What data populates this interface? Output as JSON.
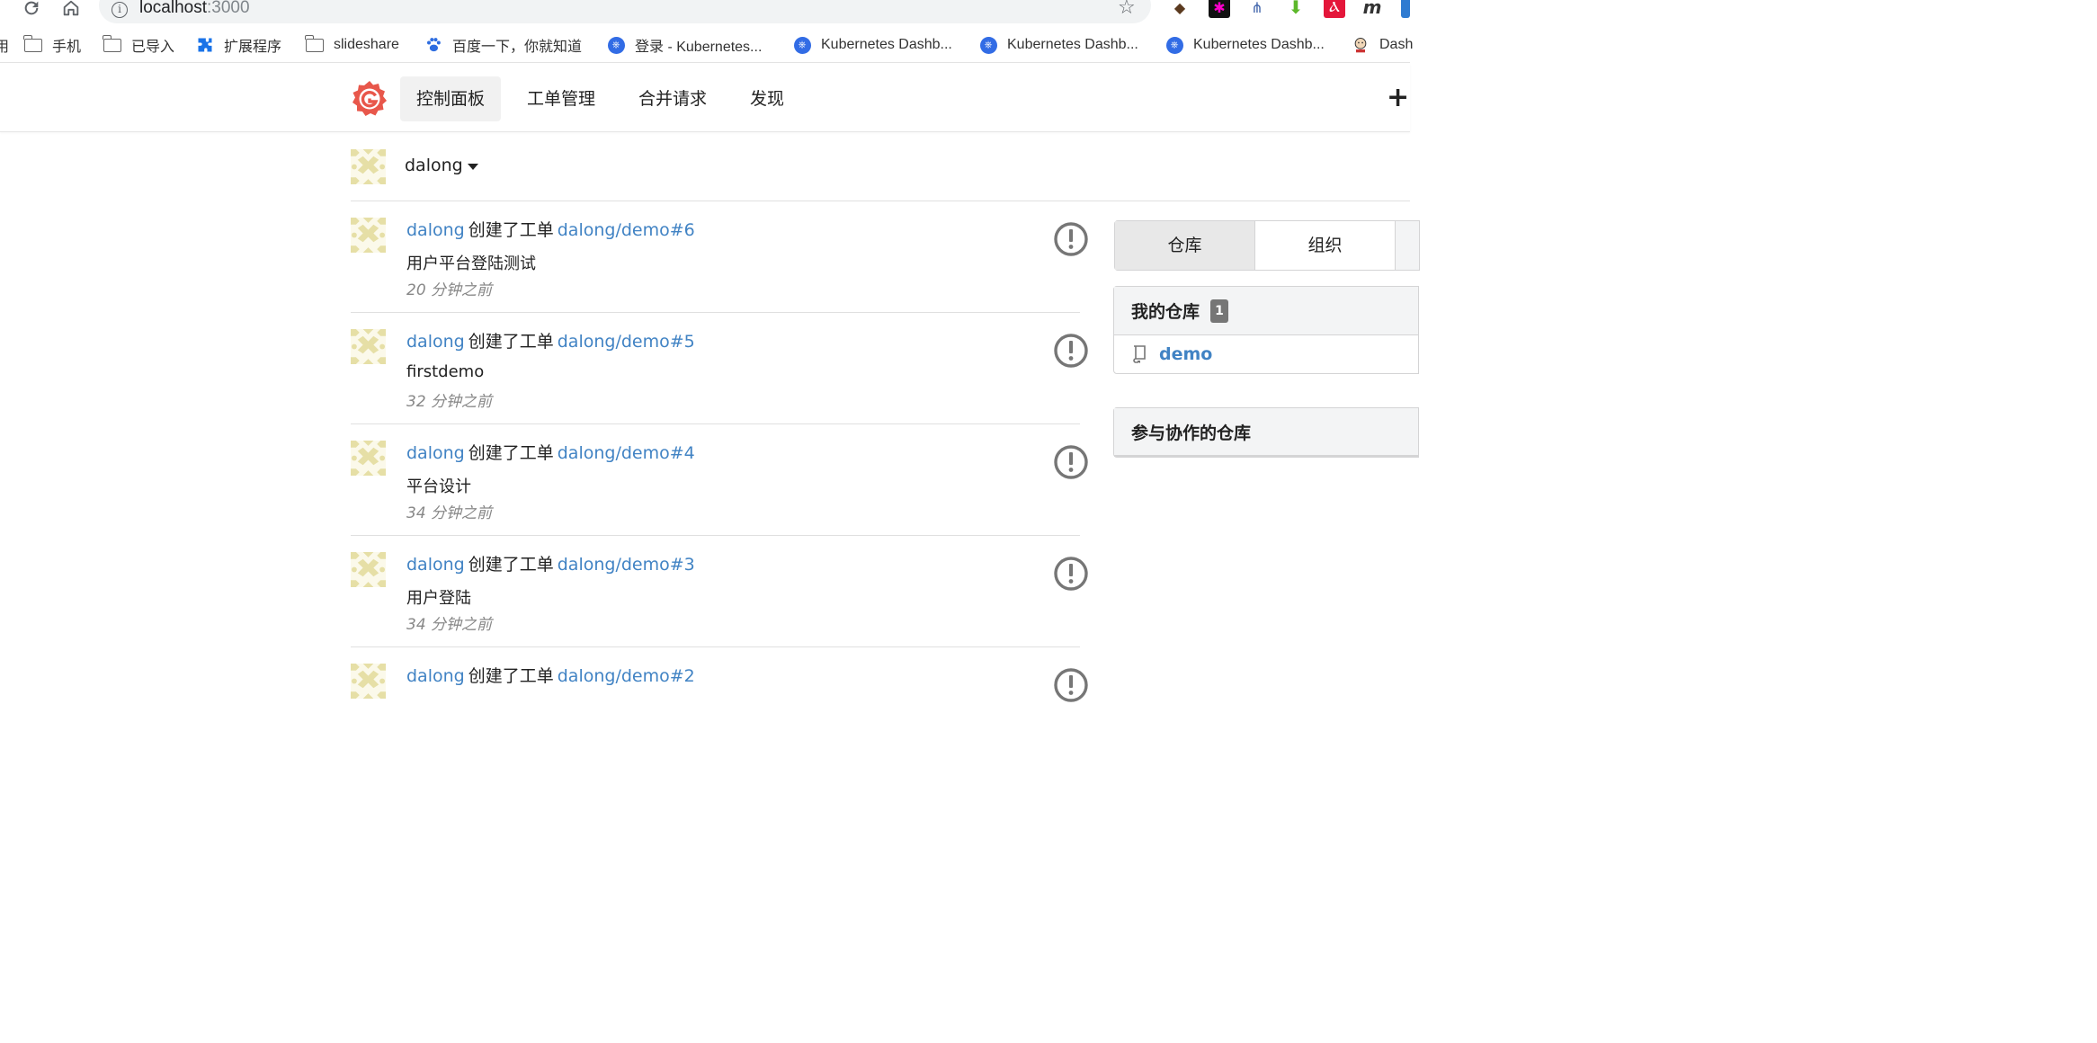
{
  "browser": {
    "url_host": "localhost",
    "url_port": ":3000",
    "bookmarks": [
      {
        "label": "手机",
        "icon": "folder-icon"
      },
      {
        "label": "已导入",
        "icon": "folder-icon"
      },
      {
        "label": "扩展程序",
        "icon": "puzzle-icon"
      },
      {
        "label": "slideshare",
        "icon": "folder-icon"
      },
      {
        "label": "百度一下，你就知道",
        "icon": "baidu-paw-icon"
      },
      {
        "label": "登录 - Kubernetes...",
        "icon": "kubernetes-icon"
      },
      {
        "label": "Kubernetes Dashb...",
        "icon": "kubernetes-icon"
      },
      {
        "label": "Kubernetes Dashb...",
        "icon": "kubernetes-icon"
      },
      {
        "label": "Kubernetes Dashb...",
        "icon": "kubernetes-icon"
      },
      {
        "label": "Dash",
        "icon": "jenkins-icon"
      }
    ],
    "left_cut_glyph": "用"
  },
  "header": {
    "nav": [
      {
        "label": "控制面板",
        "active": true
      },
      {
        "label": "工单管理",
        "active": false
      },
      {
        "label": "合并请求",
        "active": false
      },
      {
        "label": "发现",
        "active": false
      }
    ],
    "plus": "+"
  },
  "context": {
    "username": "dalong"
  },
  "feed": [
    {
      "user": "dalong",
      "verb": "创建了工单",
      "ref": "dalong/demo#6",
      "title": "用户平台登陆测试",
      "time": "20 分钟之前"
    },
    {
      "user": "dalong",
      "verb": "创建了工单",
      "ref": "dalong/demo#5",
      "title": "firstdemo",
      "time": "32 分钟之前"
    },
    {
      "user": "dalong",
      "verb": "创建了工单",
      "ref": "dalong/demo#4",
      "title": "平台设计",
      "time": "34 分钟之前"
    },
    {
      "user": "dalong",
      "verb": "创建了工单",
      "ref": "dalong/demo#3",
      "title": "用户登陆",
      "time": "34 分钟之前"
    },
    {
      "user": "dalong",
      "verb": "创建了工单",
      "ref": "dalong/demo#2",
      "title": "",
      "time": ""
    }
  ],
  "sidebar": {
    "tabs": [
      {
        "label": "仓库"
      },
      {
        "label": "组织"
      }
    ],
    "my_repos": {
      "title": "我的仓库",
      "count": "1",
      "items": [
        {
          "name": "demo"
        }
      ]
    },
    "collab_repos": {
      "title": "参与协作的仓库"
    }
  },
  "colors": {
    "link": "#4183c4",
    "gitea_logo": "#e8574b",
    "issue_icon": "#767676",
    "avatar_pattern": "#e6dfa6"
  }
}
